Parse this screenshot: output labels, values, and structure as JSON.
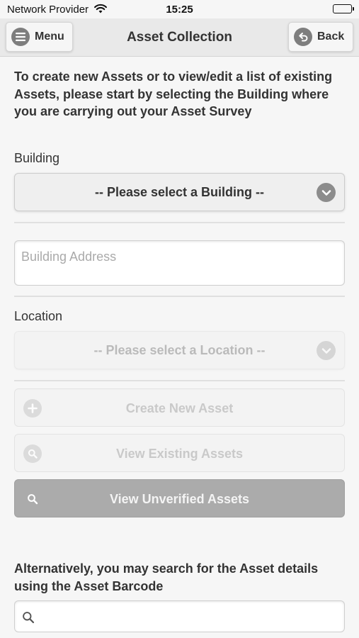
{
  "status_bar": {
    "carrier": "Network Provider",
    "time": "15:25",
    "wifi_icon": "wifi-icon",
    "battery_icon": "battery-full-icon"
  },
  "header": {
    "title": "Asset Collection",
    "menu_label": "Menu",
    "menu_icon": "hamburger-menu-icon",
    "back_label": "Back",
    "back_icon": "back-arrow-icon"
  },
  "intro_text": "To create new Assets or to view/edit a list of existing Assets, please start by selecting the Building where you are carrying out your Asset Survey",
  "building": {
    "label": "Building",
    "selected": "-- Please select a Building --",
    "address_placeholder": "Building Address",
    "address_value": ""
  },
  "location": {
    "label": "Location",
    "selected": "-- Please select a Location --",
    "enabled": false
  },
  "actions": [
    {
      "label": "Create New Asset",
      "icon": "plus-circle-icon",
      "enabled": false
    },
    {
      "label": "View Existing Assets",
      "icon": "search-icon",
      "enabled": false
    },
    {
      "label": "View Unverified Assets",
      "icon": "search-icon",
      "enabled": true
    }
  ],
  "barcode": {
    "prompt": "Alternatively, you may search for the Asset details using the Asset Barcode",
    "value": "",
    "icon": "search-icon"
  },
  "colors": {
    "background": "#f6f6f6",
    "header": "#e9e9e9",
    "unverified_button": "#ababab",
    "text": "#333333"
  }
}
